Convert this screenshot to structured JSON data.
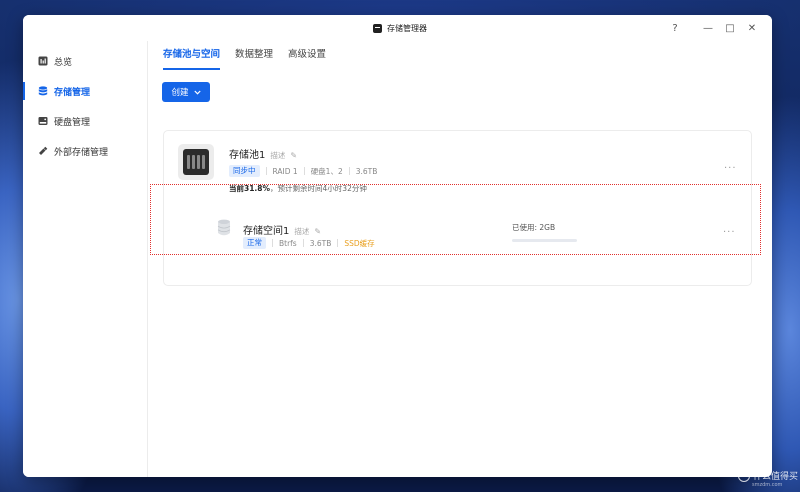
{
  "window": {
    "title": "存储管理器",
    "controls": {
      "help": "?",
      "minimize": "—",
      "maximize": "□",
      "close": "✕"
    }
  },
  "sidebar": {
    "items": [
      {
        "label": "总览",
        "icon": "overview-icon",
        "active": false
      },
      {
        "label": "存储管理",
        "icon": "database-icon",
        "active": true
      },
      {
        "label": "硬盘管理",
        "icon": "harddisk-icon",
        "active": false
      },
      {
        "label": "外部存储管理",
        "icon": "usb-drive-icon",
        "active": false
      }
    ]
  },
  "tabs": [
    {
      "label": "存储池与空间",
      "active": true
    },
    {
      "label": "数据整理",
      "active": false
    },
    {
      "label": "高级设置",
      "active": false
    }
  ],
  "create_button": {
    "label": "创建",
    "icon": "chevron-down-icon"
  },
  "pool": {
    "name": "存储池1",
    "description_placeholder": "描述",
    "status_tag": "同步中",
    "raid": "RAID 1",
    "disks": "硬盘1、2",
    "capacity": "3.6TB",
    "progress_prefix": "当前",
    "progress_value": "31.8%",
    "progress_suffix": "，预计剩余时间4小时32分钟",
    "more": "···"
  },
  "space": {
    "name": "存储空间1",
    "description_placeholder": "描述",
    "status_tag": "正常",
    "filesystem": "Btrfs",
    "capacity": "3.6TB",
    "cache": "SSD缓存",
    "used_label": "已使用: 2GB",
    "used_fraction": 0.001,
    "more": "···"
  },
  "watermark": {
    "text": "什么值得买",
    "sub": "smzdm.com"
  },
  "colors": {
    "accent": "#1565e8",
    "tag_bg": "#e3edfd",
    "ssd_orange": "#e9a020",
    "highlight_red": "#e0312f"
  }
}
